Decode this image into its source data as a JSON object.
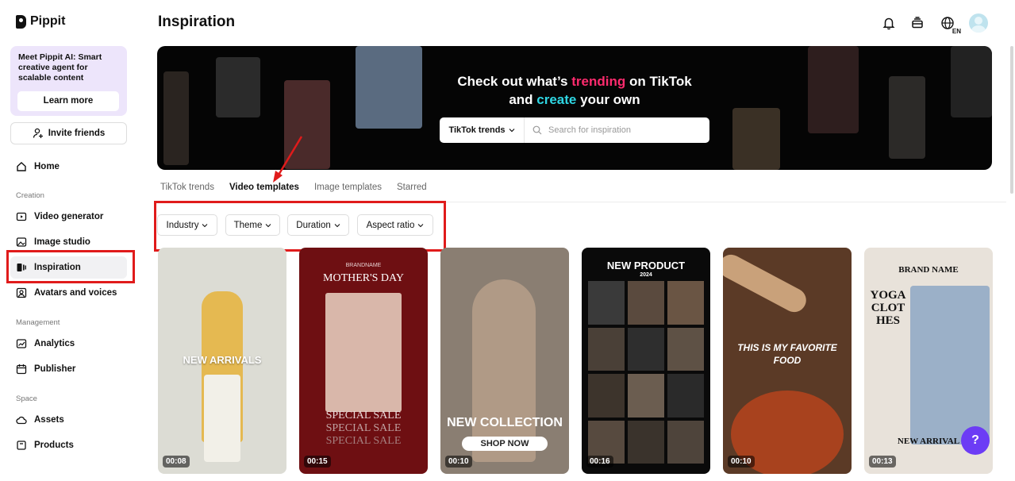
{
  "app": {
    "name": "Pippit"
  },
  "promo": {
    "text": "Meet Pippit AI: Smart creative agent for scalable content",
    "button": "Learn more"
  },
  "invite": {
    "label": "Invite friends"
  },
  "nav": {
    "home": "Home",
    "creation_label": "Creation",
    "video_generator": "Video generator",
    "image_studio": "Image studio",
    "inspiration": "Inspiration",
    "avatars": "Avatars and voices",
    "management_label": "Management",
    "analytics": "Analytics",
    "publisher": "Publisher",
    "space_label": "Space",
    "assets": "Assets",
    "products": "Products"
  },
  "header": {
    "title": "Inspiration",
    "lang": "EN"
  },
  "banner": {
    "line1_a": "Check out what’s ",
    "line1_b": "trending",
    "line1_c": " on TikTok",
    "line2_a": "and ",
    "line2_b": "create",
    "line2_c": " your own",
    "select": "TikTok trends",
    "placeholder": "Search for inspiration"
  },
  "tabs": [
    "TikTok trends",
    "Video templates",
    "Image templates",
    "Starred"
  ],
  "filters": [
    "Industry",
    "Theme",
    "Duration",
    "Aspect ratio"
  ],
  "cards": [
    {
      "caption": "NEW ARRIVALS",
      "duration": "00:08",
      "bg": "#dcdcd4"
    },
    {
      "caption_top": "BRANDNAME",
      "caption": "MOTHER'S DAY",
      "caption_bottom": "SPECIAL SALE",
      "duration": "00:15",
      "bg": "#6e0f12"
    },
    {
      "caption": "NEW COLLECTION",
      "caption_bottom": "SHOP NOW",
      "duration": "00:10",
      "bg": "#8a7e72"
    },
    {
      "caption": "NEW PRODUCT",
      "caption_top": "2024",
      "duration": "00:16",
      "bg": "#0a0a0a"
    },
    {
      "caption": "THIS IS MY FAVORITE FOOD",
      "duration": "00:10",
      "bg": "#5b3a26"
    },
    {
      "caption_top": "BRAND NAME",
      "caption": "YOGA CLOTHES",
      "caption_bottom": "NEW ARRIVAL",
      "duration": "00:13",
      "bg": "#e8e2da"
    }
  ],
  "help": {
    "label": "?"
  }
}
